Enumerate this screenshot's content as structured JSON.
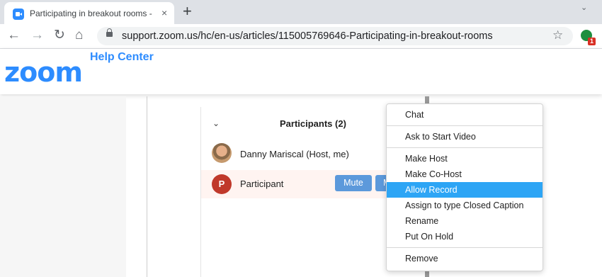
{
  "browser": {
    "tab_title": "Participating in breakout rooms -",
    "tab_close": "×",
    "new_tab": "+",
    "url": "support.zoom.us/hc/en-us/articles/115005769646-Participating-in-breakout-rooms",
    "back": "←",
    "forward": "→",
    "reload": "↻",
    "home": "⌂",
    "star": "☆",
    "extension_badge": "1",
    "tab_menu": "⌄"
  },
  "site": {
    "logo": "zoom",
    "section": "Help Center"
  },
  "participants_panel": {
    "chevron": "⌄",
    "title": "Participants (2)",
    "rows": [
      {
        "name": "Danny Mariscal (Host, me)"
      },
      {
        "initial": "P",
        "name": "Participant",
        "mute_label": "Mute",
        "more_label": "M"
      }
    ]
  },
  "context_menu": {
    "items": [
      {
        "label": "Chat"
      },
      {
        "label": "Ask to Start Video"
      },
      {
        "label": "Make Host"
      },
      {
        "label": "Make Co-Host"
      },
      {
        "label": "Allow Record",
        "highlighted": true
      },
      {
        "label": "Assign to type Closed Caption"
      },
      {
        "label": "Rename"
      },
      {
        "label": "Put On Hold"
      },
      {
        "label": "Remove"
      }
    ]
  },
  "colors": {
    "zoom_blue": "#2d8cff",
    "menu_highlight": "#2da5f5",
    "button_blue": "#5c99db",
    "participant_avatar": "#c0392b"
  }
}
